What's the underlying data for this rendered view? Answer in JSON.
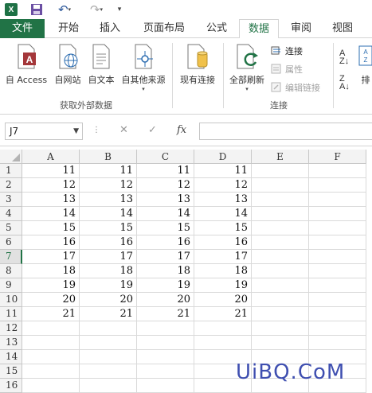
{
  "app": {
    "logo_text": "X"
  },
  "tabs": [
    {
      "label": "文件"
    },
    {
      "label": "开始"
    },
    {
      "label": "插入"
    },
    {
      "label": "页面布局"
    },
    {
      "label": "公式"
    },
    {
      "label": "数据"
    },
    {
      "label": "审阅"
    },
    {
      "label": "视图"
    }
  ],
  "ribbon": {
    "external_data": {
      "buttons": [
        "自 Access",
        "自网站",
        "自文本",
        "自其他来源"
      ],
      "group_label": "获取外部数据"
    },
    "existing_connections": "现有连接",
    "connections": {
      "refresh_all": "全部刷新",
      "connections": "连接",
      "properties": "属性",
      "edit_links": "编辑链接",
      "group_label": "连接"
    },
    "sort": {
      "label": "排"
    },
    "icons": [
      "access-icon",
      "web-icon",
      "text-file-icon",
      "other-sources-icon",
      "existing-connections-icon",
      "refresh-icon",
      "connections-icon",
      "properties-icon",
      "edit-links-icon",
      "sort-asc-icon",
      "sort-desc-icon",
      "sort-icon"
    ]
  },
  "formula_bar": {
    "name_box": "J7",
    "fx": "fx",
    "formula": ""
  },
  "grid": {
    "columns": [
      "A",
      "B",
      "C",
      "D",
      "E",
      "F"
    ],
    "rows": [
      {
        "num": "1",
        "cells": [
          "11",
          "11",
          "11",
          "11"
        ]
      },
      {
        "num": "2",
        "cells": [
          "12",
          "12",
          "12",
          "12"
        ]
      },
      {
        "num": "3",
        "cells": [
          "13",
          "13",
          "13",
          "13"
        ]
      },
      {
        "num": "4",
        "cells": [
          "14",
          "14",
          "14",
          "14"
        ]
      },
      {
        "num": "5",
        "cells": [
          "15",
          "15",
          "15",
          "15"
        ]
      },
      {
        "num": "6",
        "cells": [
          "16",
          "16",
          "16",
          "16"
        ]
      },
      {
        "num": "7",
        "cells": [
          "17",
          "17",
          "17",
          "17"
        ]
      },
      {
        "num": "8",
        "cells": [
          "18",
          "18",
          "18",
          "18"
        ]
      },
      {
        "num": "9",
        "cells": [
          "19",
          "19",
          "19",
          "19"
        ]
      },
      {
        "num": "10",
        "cells": [
          "20",
          "20",
          "20",
          "20"
        ]
      },
      {
        "num": "11",
        "cells": [
          "21",
          "21",
          "21",
          "21"
        ]
      },
      {
        "num": "12",
        "cells": []
      },
      {
        "num": "13",
        "cells": []
      },
      {
        "num": "14",
        "cells": []
      },
      {
        "num": "15",
        "cells": []
      },
      {
        "num": "16",
        "cells": []
      }
    ],
    "active_row": "7"
  },
  "watermark": "UiBQ.CoM",
  "colors": {
    "accent": "#217346",
    "watermark": "#3f4fb0"
  }
}
